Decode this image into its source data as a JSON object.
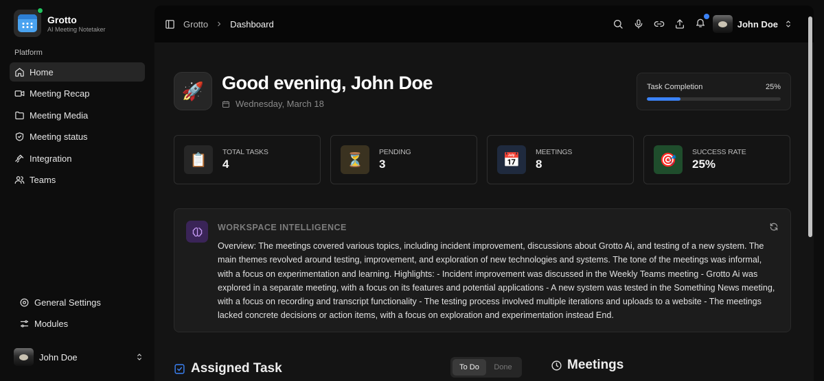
{
  "brand": {
    "name": "Grotto",
    "tagline": "AI Meeting Notetaker"
  },
  "sidebar": {
    "section_label": "Platform",
    "items": [
      {
        "label": "Home",
        "icon": "home-icon",
        "active": true
      },
      {
        "label": "Meeting Recap",
        "icon": "video-icon",
        "active": false
      },
      {
        "label": "Meeting Media",
        "icon": "folder-icon",
        "active": false
      },
      {
        "label": "Meeting status",
        "icon": "shield-icon",
        "active": false
      },
      {
        "label": "Integration",
        "icon": "plug-icon",
        "active": false
      },
      {
        "label": "Teams",
        "icon": "users-icon",
        "active": false
      }
    ],
    "bottom_items": [
      {
        "label": "General Settings",
        "icon": "gear-icon"
      },
      {
        "label": "Modules",
        "icon": "sliders-icon"
      }
    ],
    "user_name": "John Doe"
  },
  "topbar": {
    "breadcrumb": [
      "Grotto",
      "Dashboard"
    ],
    "user_name": "John Doe",
    "icons": [
      "search-icon",
      "mic-icon",
      "link-icon",
      "upload-icon",
      "bell-icon"
    ]
  },
  "greeting": {
    "title": "Good evening, John Doe",
    "date": "Wednesday, March 18",
    "icon": "🚀"
  },
  "completion": {
    "label": "Task Completion",
    "value_text": "25%",
    "percent": 25,
    "accent": "#3b82f6"
  },
  "stats": [
    {
      "label": "Total Tasks",
      "value": "4",
      "icon": "📋",
      "bg": "#262626"
    },
    {
      "label": "Pending",
      "value": "3",
      "icon": "⏳",
      "bg": "#3a3220"
    },
    {
      "label": "Meetings",
      "value": "8",
      "icon": "📅",
      "bg": "#1f2a3e"
    },
    {
      "label": "Success Rate",
      "value": "25%",
      "icon": "🎯",
      "bg": "#1f4d2c"
    }
  ],
  "intelligence": {
    "title": "Workspace Intelligence",
    "body": "Overview: The meetings covered various topics, including incident improvement, discussions about Grotto Ai, and testing of a new system. The main themes revolved around testing, improvement, and exploration of new technologies and systems. The tone of the meetings was informal, with a focus on experimentation and learning. Highlights: - Incident improvement was discussed in the Weekly Teams meeting - Grotto Ai was explored in a separate meeting, with a focus on its features and potential applications - A new system was tested in the Something News meeting, with a focus on recording and transcript functionality - The testing process involved multiple iterations and uploads to a website - The meetings lacked concrete decisions or action items, with a focus on exploration and experimentation instead End."
  },
  "tasks": {
    "title": "Assigned Task",
    "toggle": [
      "To Do",
      "Done"
    ]
  },
  "meetings": {
    "title": "Meetings"
  }
}
